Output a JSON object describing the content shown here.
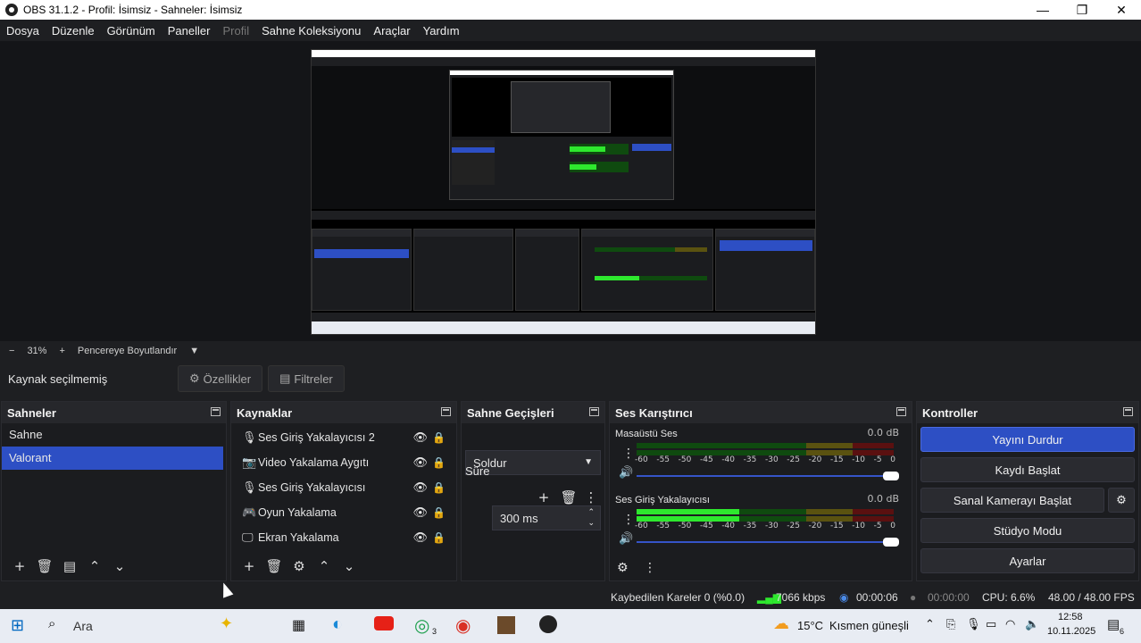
{
  "window": {
    "title": "OBS 31.1.2 - Profil: İsimsiz - Sahneler: İsimsiz",
    "controls": [
      "—",
      "❐",
      "✕"
    ]
  },
  "menu": [
    {
      "label": "Dosya",
      "enabled": true
    },
    {
      "label": "Düzenle",
      "enabled": true
    },
    {
      "label": "Görünüm",
      "enabled": true
    },
    {
      "label": "Paneller",
      "enabled": true
    },
    {
      "label": "Profil",
      "enabled": false
    },
    {
      "label": "Sahne Koleksiyonu",
      "enabled": true
    },
    {
      "label": "Araçlar",
      "enabled": true
    },
    {
      "label": "Yardım",
      "enabled": true
    }
  ],
  "zoom": {
    "minus": "−",
    "value": "31%",
    "plus": "+",
    "mode": "Pencereye Boyutlandır",
    "dropdown": "▼"
  },
  "context": {
    "no_source": "Kaynak seçilmemiş",
    "properties": "Özellikler",
    "filters": "Filtreler"
  },
  "scenes": {
    "title": "Sahneler",
    "items": [
      {
        "label": "Sahne",
        "selected": false
      },
      {
        "label": "Valorant",
        "selected": true
      }
    ]
  },
  "sources": {
    "title": "Kaynaklar",
    "items": [
      {
        "label": "Ses Giriş Yakalayıcısı 2",
        "icon": "mic-icon"
      },
      {
        "label": "Video Yakalama Aygıtı",
        "icon": "camera-icon"
      },
      {
        "label": "Ses Giriş Yakalayıcısı",
        "icon": "mic-icon"
      },
      {
        "label": "Oyun Yakalama",
        "icon": "gamepad-icon"
      },
      {
        "label": "Ekran Yakalama",
        "icon": "monitor-icon"
      }
    ]
  },
  "transitions": {
    "title": "Sahne Geçişleri",
    "selected": "Soldur",
    "duration_label": "Süre",
    "duration_value": "300 ms"
  },
  "mixer": {
    "title": "Ses Karıştırıcı",
    "ticks": [
      "-60",
      "-55",
      "-50",
      "-45",
      "-40",
      "-35",
      "-30",
      "-25",
      "-20",
      "-15",
      "-10",
      "-5",
      "0"
    ],
    "channels": [
      {
        "name": "Masaüstü Ses",
        "db": "0.0 dB",
        "level": 0,
        "volume": 1.0
      },
      {
        "name": "Ses Giriş Yakalayıcısı",
        "db": "0.0 dB",
        "level": 0.4,
        "volume": 1.0
      }
    ]
  },
  "controls": {
    "title": "Kontroller",
    "stop_stream": "Yayını Durdur",
    "start_record": "Kaydı Başlat",
    "start_virtualcam": "Sanal Kamerayı Başlat",
    "studio_mode": "Stüdyo Modu",
    "settings": "Ayarlar"
  },
  "status": {
    "dropped_frames": "Kaybedilen Kareler 0 (%0.0)",
    "bitrate": "7066 kbps",
    "stream_time": "00:00:06",
    "record_time": "00:00:00",
    "cpu": "CPU: 6.6%",
    "fps": "48.00 / 48.00 FPS"
  },
  "taskbar": {
    "search": "Ara",
    "weather_temp": "15°C",
    "weather_text": "Kısmen güneşli",
    "time": "12:58",
    "date": "10.11.2025",
    "whatsapp_badge": "3",
    "notif_badge": "6"
  },
  "colors": {
    "accent": "#2d4fc4",
    "bg": "#1e1f22",
    "dock_header": "#26272b",
    "meter_green": "#2ee82e"
  }
}
